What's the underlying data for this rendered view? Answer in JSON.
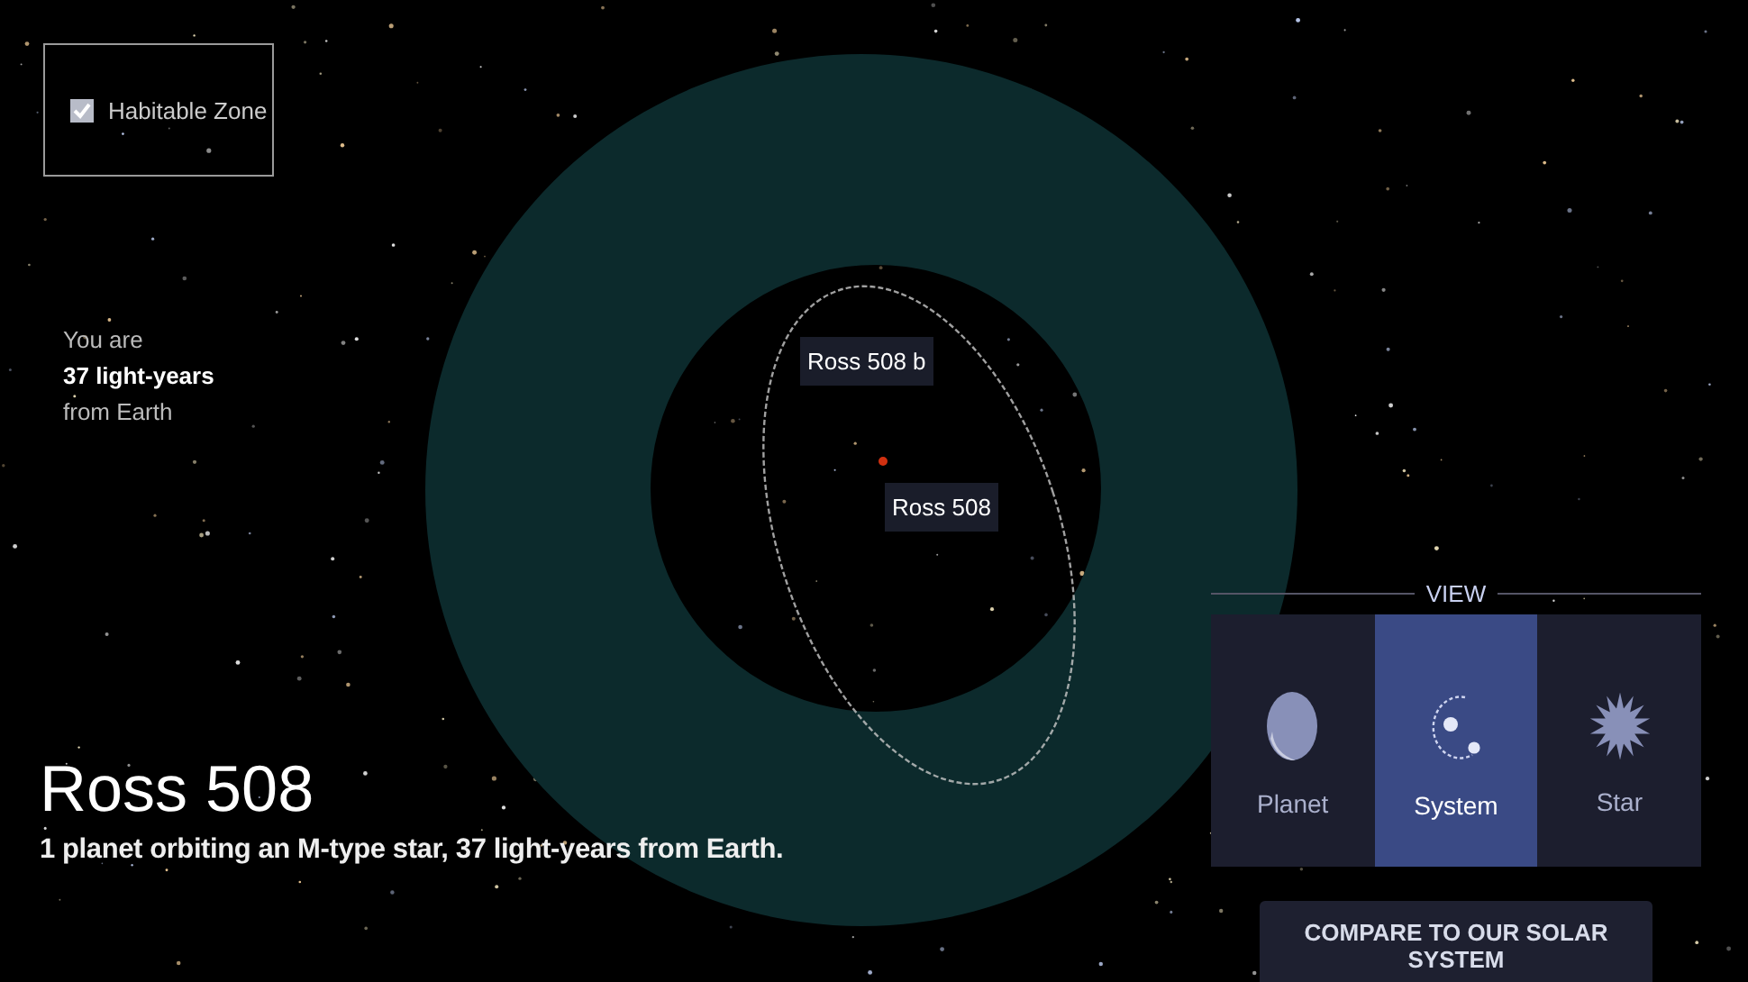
{
  "habitable_zone": {
    "label": "Habitable Zone",
    "checked": true
  },
  "distance": {
    "line_1": "You are",
    "line_2": "37 light-years",
    "line_3": "from Earth"
  },
  "map_labels": [
    {
      "text": "Ross 508 b",
      "kind": "planet"
    },
    {
      "text": "Ross 508",
      "kind": "star"
    }
  ],
  "title": "Ross 508",
  "subtitle": "1 planet orbiting an M-type star, 37 light-years from Earth.",
  "view": {
    "heading": "VIEW",
    "options": [
      {
        "label": "Planet",
        "kind": "planet",
        "selected": false
      },
      {
        "label": "System",
        "kind": "system",
        "selected": true
      },
      {
        "label": "Star",
        "kind": "star",
        "selected": false
      }
    ]
  },
  "compare_button": "COMPARE TO OUR SOLAR SYSTEM"
}
